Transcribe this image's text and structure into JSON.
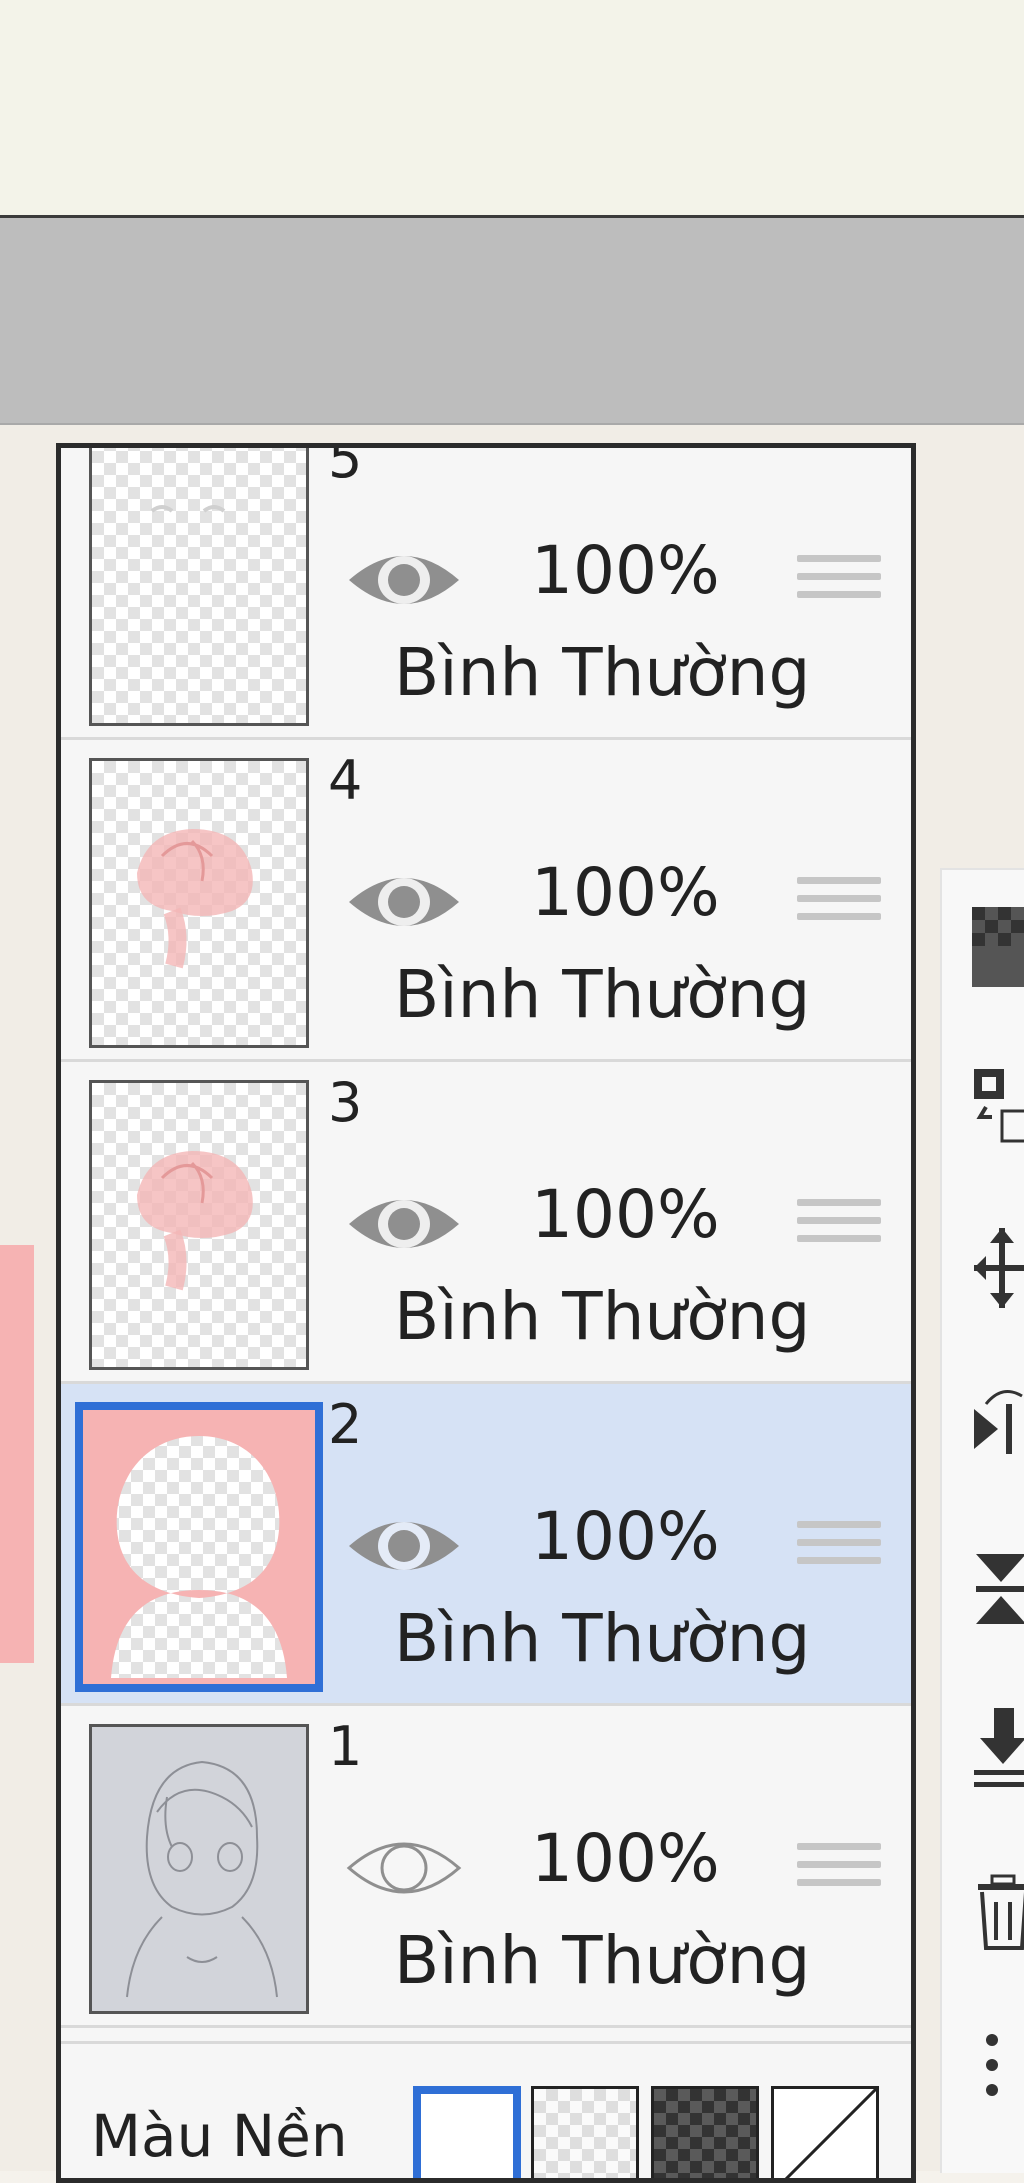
{
  "layers": [
    {
      "number": "5",
      "opacity": "100%",
      "blend": "Bình Thường",
      "visible": true,
      "selected": false,
      "thumb": "eyes-sketch"
    },
    {
      "number": "4",
      "opacity": "100%",
      "blend": "Bình Thường",
      "visible": true,
      "selected": false,
      "thumb": "pink-hair"
    },
    {
      "number": "3",
      "opacity": "100%",
      "blend": "Bình Thường",
      "visible": true,
      "selected": false,
      "thumb": "pink-hair"
    },
    {
      "number": "2",
      "opacity": "100%",
      "blend": "Bình Thường",
      "visible": true,
      "selected": true,
      "thumb": "pink-silhouette"
    },
    {
      "number": "1",
      "opacity": "100%",
      "blend": "Bình Thường",
      "visible": false,
      "selected": false,
      "thumb": "line-sketch"
    }
  ],
  "background": {
    "label": "Màu Nền",
    "options": [
      "white",
      "light-checker",
      "dark-checker",
      "none"
    ],
    "selected": "white"
  },
  "toolbar": {
    "icons": [
      "checkerboard-icon",
      "copy-layer-icon",
      "move-icon",
      "flip-horizontal-icon",
      "flip-vertical-icon",
      "merge-down-icon",
      "trash-icon",
      "more-icon"
    ]
  },
  "colors": {
    "accent": "#2f6fd6",
    "selected_row": "#d6e2f5",
    "layer_fill_pink": "#f6b3b3"
  }
}
